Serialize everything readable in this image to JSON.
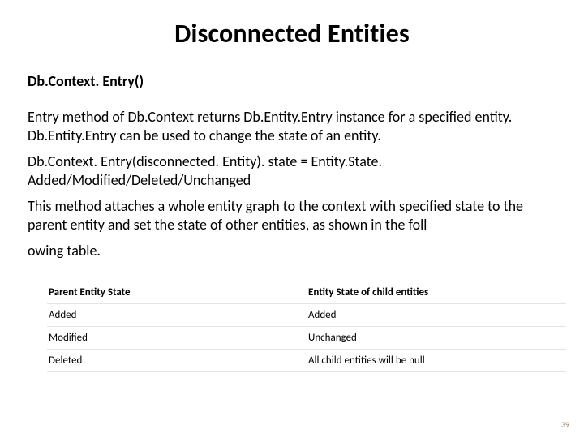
{
  "title": "Disconnected Entities",
  "subheading": "Db.Context. Entry()",
  "paragraphs": {
    "p1": "Entry method of Db.Context returns Db.Entity.Entry instance for a specified entity. Db.Entity.Entry can be used to change the state of an entity.",
    "p2": "Db.Context. Entry(disconnected. Entity). state = Entity.State. Added/Modified/Deleted/Unchanged",
    "p3": "This method attaches a whole entity graph to the context with specified state to the parent entity and set the state of other entities, as shown in the foll",
    "p4": "owing table."
  },
  "table": {
    "headers": {
      "col1": "Parent Entity State",
      "col2": "Entity State of child entities"
    },
    "rows": [
      {
        "c1": "Added",
        "c2": "Added"
      },
      {
        "c1": "Modified",
        "c2": "Unchanged"
      },
      {
        "c1": "Deleted",
        "c2": "All child entities will be null"
      }
    ]
  },
  "pageNumber": "39"
}
